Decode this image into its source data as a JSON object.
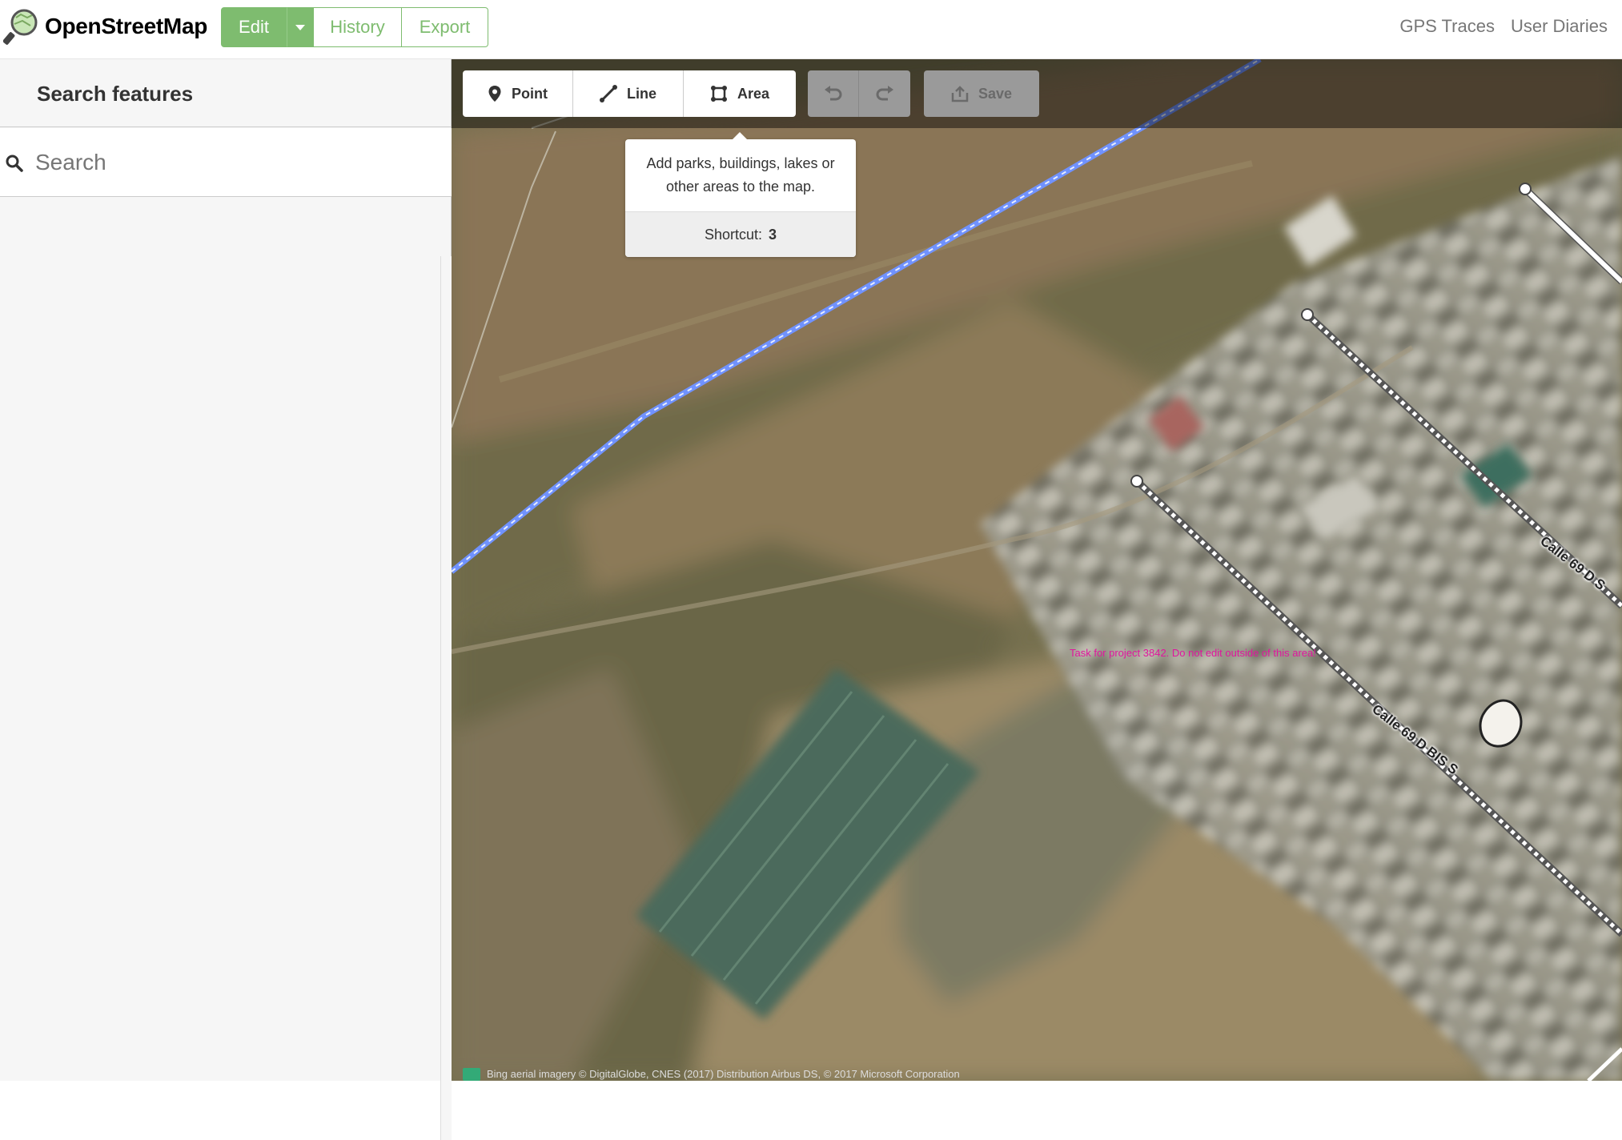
{
  "header": {
    "logo_text": "OpenStreetMap",
    "tabs": {
      "edit": "Edit",
      "history": "History",
      "export": "Export"
    },
    "right_links": [
      "GPS Traces",
      "User Diaries"
    ]
  },
  "sidebar": {
    "title": "Search features",
    "search_placeholder": "Search"
  },
  "map": {
    "toolbar": {
      "point": "Point",
      "line": "Line",
      "area": "Area",
      "save": "Save"
    },
    "tooltip": {
      "text": "Add parks, buildings, lakes or other areas to the map.",
      "shortcut_label": "Shortcut:",
      "shortcut_key": "3"
    },
    "task_label": "Task for project 3842. Do not edit outside of this area!",
    "streets": [
      "Calle 69 D S",
      "Calle 69 D BIS S"
    ],
    "attribution": "Bing aerial imagery © DigitalGlobe, CNES (2017) Distribution Airbus DS, © 2017 Microsoft Corporation"
  },
  "colors": {
    "osm_green": "#7ebc6f",
    "waterway_blue": "#7092ff",
    "task_magenta": "#e0169e"
  }
}
